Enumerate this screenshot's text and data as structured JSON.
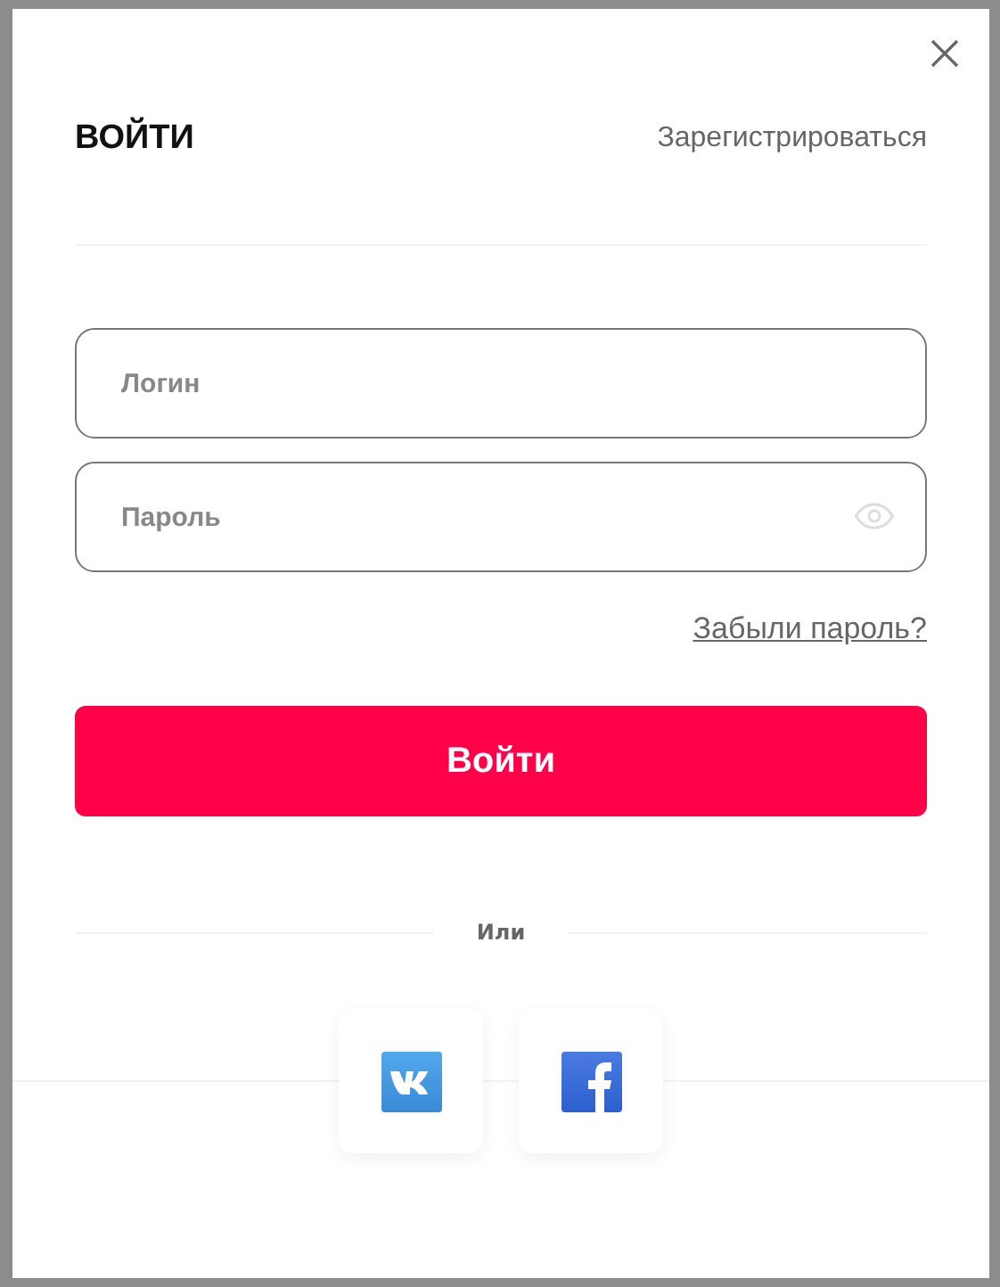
{
  "dialog": {
    "title": "ВОЙТИ",
    "register_link": "Зарегистрироваться"
  },
  "fields": [
    {
      "placeholder": "Логин",
      "kind": "text"
    },
    {
      "placeholder": "Пароль",
      "kind": "password"
    }
  ],
  "forgot_link": "Забыли пароль?",
  "submit": "Войти",
  "separator": "Или",
  "social": [
    {
      "kind": "vk"
    },
    {
      "kind": "facebook"
    }
  ]
}
